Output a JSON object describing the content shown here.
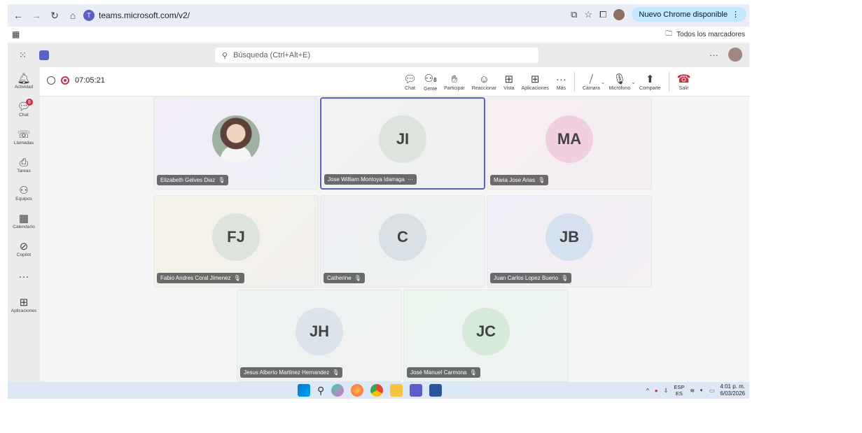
{
  "browser": {
    "url": "teams.microsoft.com/v2/",
    "update_label": "Nuevo Chrome disponible",
    "bookmarks_folder": "Todos los marcadores"
  },
  "teams": {
    "search_placeholder": "Búsqueda (Ctrl+Alt+E)",
    "more_label": "···"
  },
  "rail": [
    {
      "label": "Actividad",
      "icon": "bell-icon",
      "glyph": "🔔︎"
    },
    {
      "label": "Chat",
      "icon": "chat-icon",
      "glyph": "💬︎",
      "badge": "8"
    },
    {
      "label": "Llamadas",
      "icon": "phone-icon",
      "glyph": "☏"
    },
    {
      "label": "Tareas",
      "icon": "tasks-icon",
      "glyph": "⎙"
    },
    {
      "label": "Equipos",
      "icon": "teams-icon",
      "glyph": "⚇"
    },
    {
      "label": "Calendario",
      "icon": "calendar-icon",
      "glyph": "▦"
    },
    {
      "label": "Copilot",
      "icon": "copilot-icon",
      "glyph": "⊘"
    },
    {
      "label": "",
      "icon": "more-icon",
      "glyph": "···"
    },
    {
      "label": "Aplicaciones",
      "icon": "apps-add-icon",
      "glyph": "⊞"
    }
  ],
  "meeting": {
    "timer": "07:05:21",
    "people_count": "8",
    "toolbar": {
      "chat": "Chat",
      "people": "Gente",
      "raise": "Participar",
      "react": "Reaccionar",
      "view": "Vista",
      "apps": "Aplicaciones",
      "more": "Más",
      "camera": "Cámara",
      "mic": "Micrófono",
      "share": "Comparte",
      "leave": "Salir"
    }
  },
  "participants": [
    {
      "name": "Elizabeth Gelves Diaz",
      "initials": "",
      "photo": true
    },
    {
      "name": "Jose William Montoya Idarraga",
      "initials": "JI",
      "active": true
    },
    {
      "name": "Maria Jose Arias",
      "initials": "MA"
    },
    {
      "name": "Fabio Andres Coral Jimenez",
      "initials": "FJ"
    },
    {
      "name": "Catherine",
      "initials": "C"
    },
    {
      "name": "Juan Carlos Lopez Bueno",
      "initials": "JB"
    },
    {
      "name": "Jesus Alberto Martinez Hernandez",
      "initials": "JH"
    },
    {
      "name": "José Manuel Carmona",
      "initials": "JC"
    }
  ],
  "taskbar": {
    "lang_top": "ESP",
    "lang_bottom": "ES",
    "time": "4:01 p. m.",
    "date": "6/03/2026"
  },
  "colors": {
    "teams_accent": "#5b5fc7",
    "leave_red": "#c4314b",
    "chrome_update": "#c2e7ff"
  }
}
